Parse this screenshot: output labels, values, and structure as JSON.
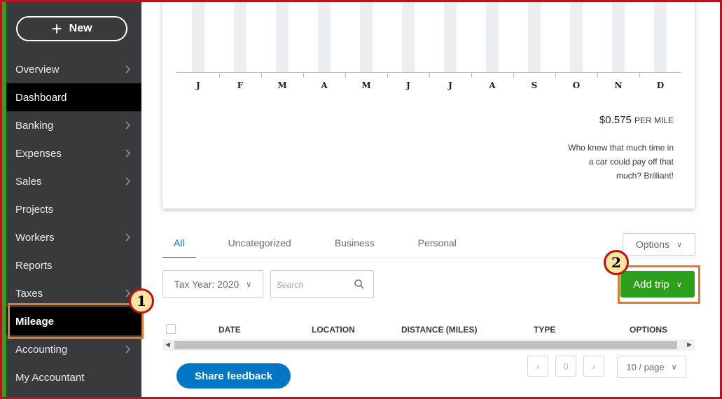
{
  "sidebar": {
    "new_label": "New",
    "items": [
      {
        "label": "Overview",
        "chevron": true
      },
      {
        "label": "Dashboard",
        "chevron": false
      },
      {
        "label": "Banking",
        "chevron": true
      },
      {
        "label": "Expenses",
        "chevron": true
      },
      {
        "label": "Sales",
        "chevron": true
      },
      {
        "label": "Projects",
        "chevron": false
      },
      {
        "label": "Workers",
        "chevron": true
      },
      {
        "label": "Reports",
        "chevron": false
      },
      {
        "label": "Taxes",
        "chevron": true
      },
      {
        "label": "Mileage",
        "chevron": false
      },
      {
        "label": "Accounting",
        "chevron": true
      },
      {
        "label": "My Accountant",
        "chevron": false
      }
    ]
  },
  "chart_data": {
    "type": "bar",
    "categories": [
      "J",
      "F",
      "M",
      "A",
      "M",
      "J",
      "J",
      "A",
      "S",
      "O",
      "N",
      "D"
    ]
  },
  "rate": {
    "value": "$0.575",
    "unit": "PER MILE"
  },
  "quote_lines": [
    "Who knew that much time in",
    "a car could pay off that",
    "much? Brilliant!"
  ],
  "tabs": [
    "All",
    "Uncategorized",
    "Business",
    "Personal"
  ],
  "options_label": "Options",
  "tax_year_label": "Tax Year: 2020",
  "search_placeholder": "Search",
  "add_trip_label": "Add trip",
  "table_headers": [
    "DATE",
    "LOCATION",
    "DISTANCE (MILES)",
    "TYPE",
    "OPTIONS"
  ],
  "share_feedback_label": "Share feedback",
  "pagination": {
    "current_page": "0",
    "page_size": "10 / page"
  },
  "badges": [
    "1",
    "2"
  ],
  "colors": {
    "sidebar_bg": "#393a3d",
    "accent_green": "#2ca01c",
    "accent_blue": "#0077c5",
    "frame_red": "#b3171c",
    "highlight_orange": "#e07b2c"
  }
}
